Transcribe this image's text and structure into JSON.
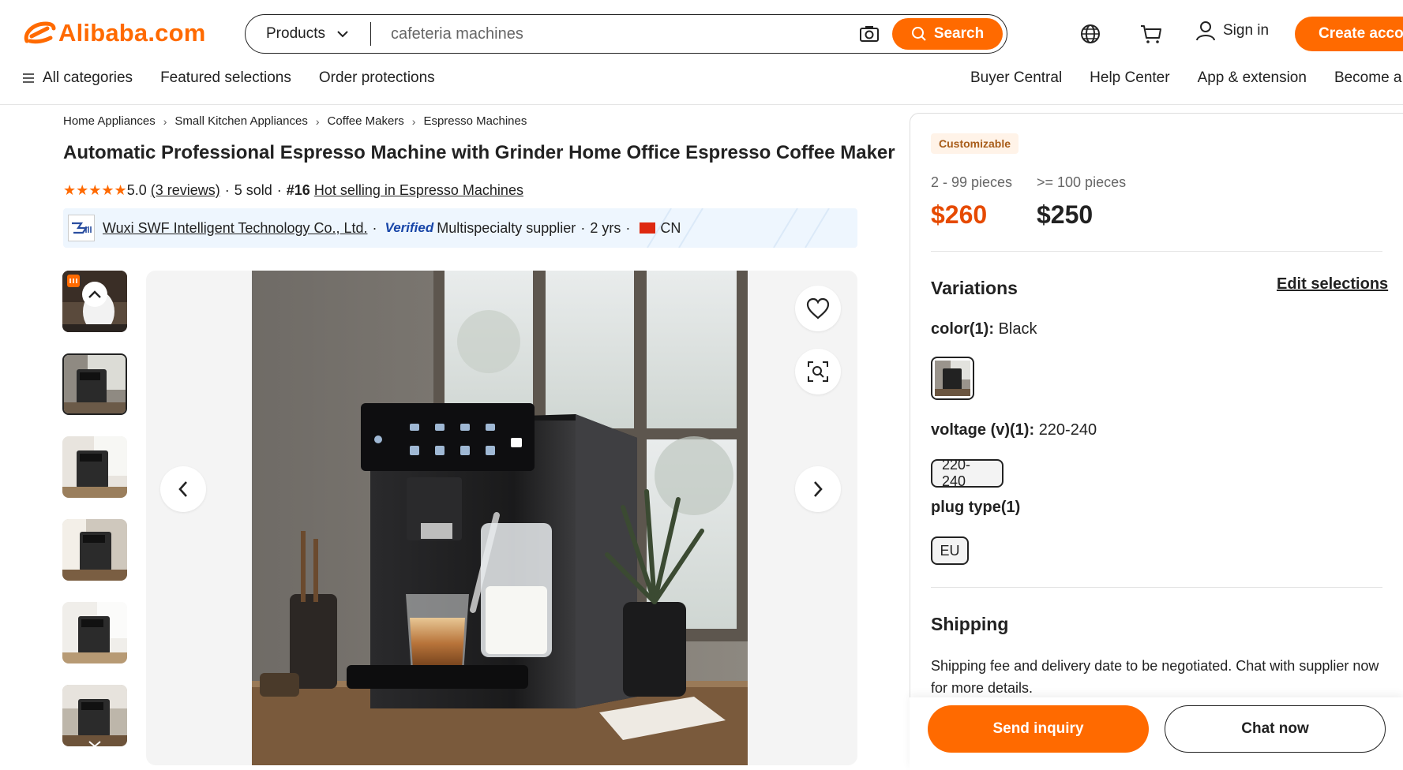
{
  "header": {
    "logo_text": "Alibaba.com",
    "search_category": "Products",
    "search_placeholder": "cafeteria machines",
    "search_button": "Search",
    "sign_in": "Sign in",
    "create_account": "Create account",
    "nav_left": [
      "All categories",
      "Featured selections",
      "Order protections"
    ],
    "nav_right": [
      "Buyer Central",
      "Help Center",
      "App & extension",
      "Become a supplier"
    ]
  },
  "breadcrumb": [
    "Home Appliances",
    "Small Kitchen Appliances",
    "Coffee Makers",
    "Espresso Machines"
  ],
  "product": {
    "title": "Automatic Professional Espresso Machine with Grinder Home Office Espresso Coffee Maker",
    "stars": "★★★★★",
    "rating": "5.0",
    "reviews": "(3 reviews)",
    "sold": "5 sold",
    "rank": "#16",
    "rank_link": "Hot selling in Espresso Machines"
  },
  "supplier": {
    "name": "Wuxi SWF Intelligent Technology Co., Ltd.",
    "verified": "Verified",
    "type": "Multispecialty supplier",
    "years": "2 yrs",
    "country": "CN"
  },
  "panel": {
    "badge": "Customizable",
    "tiers": [
      {
        "qty": "2 - 99 pieces",
        "price": "$260"
      },
      {
        "qty": ">= 100 pieces",
        "price": "$250"
      }
    ],
    "variations_title": "Variations",
    "edit_selections": "Edit selections",
    "color_label": "color(1):",
    "color_value": "Black",
    "voltage_label": "voltage (v)(1):",
    "voltage_value": "220-240",
    "voltage_chip": "220-240",
    "plug_label": "plug type(1)",
    "plug_chip": "EU",
    "shipping_title": "Shipping",
    "shipping_text": "Shipping fee and delivery date to be negotiated. Chat with supplier now for more details.",
    "send_inquiry": "Send inquiry",
    "chat_now": "Chat now"
  },
  "colors": {
    "accent": "#ff6a00",
    "price_accent": "#e64a00",
    "text": "#222222",
    "verified_blue": "#1846a8"
  }
}
